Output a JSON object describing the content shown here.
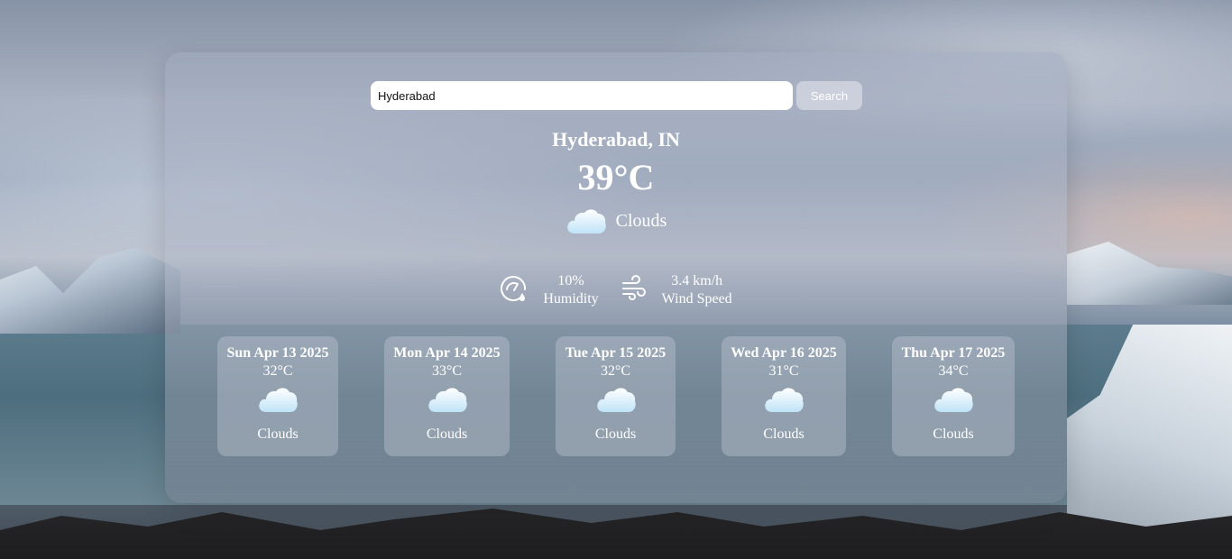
{
  "search": {
    "value": "Hyderabad",
    "button_label": "Search"
  },
  "current": {
    "location": "Hyderabad, IN",
    "temperature": "39°C",
    "condition": "Clouds",
    "condition_icon": "cloud-icon",
    "humidity_value": "10%",
    "humidity_label": "Humidity",
    "humidity_icon": "humidity-gauge-icon",
    "wind_value": "3.4 km/h",
    "wind_label": "Wind Speed",
    "wind_icon": "wind-icon"
  },
  "forecast": [
    {
      "day": "Sun Apr 13 2025",
      "temp": "32°C",
      "icon": "cloud-icon",
      "desc": "Clouds"
    },
    {
      "day": "Mon Apr 14 2025",
      "temp": "33°C",
      "icon": "cloud-icon",
      "desc": "Clouds"
    },
    {
      "day": "Tue Apr 15 2025",
      "temp": "32°C",
      "icon": "cloud-icon",
      "desc": "Clouds"
    },
    {
      "day": "Wed Apr 16 2025",
      "temp": "31°C",
      "icon": "cloud-icon",
      "desc": "Clouds"
    },
    {
      "day": "Thu Apr 17 2025",
      "temp": "34°C",
      "icon": "cloud-icon",
      "desc": "Clouds"
    }
  ]
}
